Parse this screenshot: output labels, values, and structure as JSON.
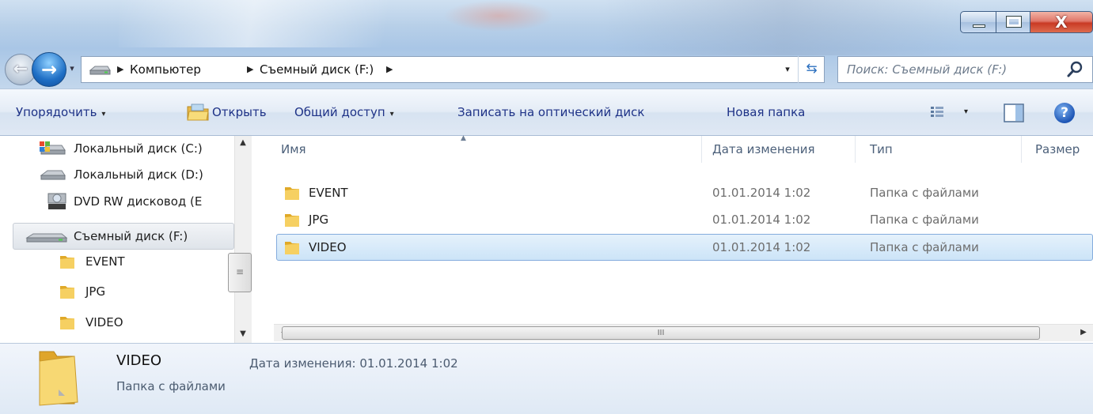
{
  "window": {
    "minimize_label": "minimize",
    "maximize_label": "maximize",
    "close_glyph": "X"
  },
  "navigation": {
    "back_glyph": "←",
    "forward_glyph": "→",
    "recent_glyph": "▾"
  },
  "address": {
    "crumbs": [
      "Компьютер",
      "Съемный диск (F:)"
    ],
    "separator_glyph": "▶",
    "dropdown_glyph": "▾",
    "refresh_glyph": "⇆"
  },
  "search": {
    "placeholder": "Поиск: Съемный диск (F:)"
  },
  "toolbar": {
    "organize": "Упорядочить",
    "open": "Открыть",
    "share": "Общий доступ",
    "burn": "Записать на оптический диск",
    "new_folder": "Новая папка",
    "caret": "▾",
    "help_glyph": "?"
  },
  "nav_pane": {
    "items": [
      {
        "label": "Локальный диск (C:)",
        "icon": "system-drive-icon"
      },
      {
        "label": "Локальный диск (D:)",
        "icon": "hard-drive-icon"
      },
      {
        "label": "DVD RW дисковод (E",
        "icon": "dvd-drive-icon"
      },
      {
        "label": "Съемный диск (F:)",
        "icon": "removable-drive-icon"
      },
      {
        "label": "EVENT",
        "icon": "folder-icon"
      },
      {
        "label": "JPG",
        "icon": "folder-icon"
      },
      {
        "label": "VIDEO",
        "icon": "folder-icon"
      }
    ],
    "scroll_up": "▲",
    "scroll_down": "▼",
    "grip": "≡"
  },
  "file_list": {
    "columns": [
      "Имя",
      "Дата изменения",
      "Тип",
      "Размер"
    ],
    "sort_glyph": "▲",
    "rows": [
      {
        "name": "EVENT",
        "date": "01.01.2014 1:02",
        "type": "Папка с файлами"
      },
      {
        "name": "JPG",
        "date": "01.01.2014 1:02",
        "type": "Папка с файлами"
      },
      {
        "name": "VIDEO",
        "date": "01.01.2014 1:02",
        "type": "Папка с файлами"
      }
    ],
    "selected_row": "VIDEO",
    "scroll_left": "◀",
    "scroll_right": "▶",
    "grip": "III"
  },
  "details": {
    "name": "VIDEO",
    "type": "Папка с файлами",
    "date_label": "Дата изменения: 01.01.2014 1:02"
  },
  "colors": {
    "folder": "#f2c94c",
    "selection": "#cce4f8",
    "toolbar_text": "#1e3287"
  }
}
